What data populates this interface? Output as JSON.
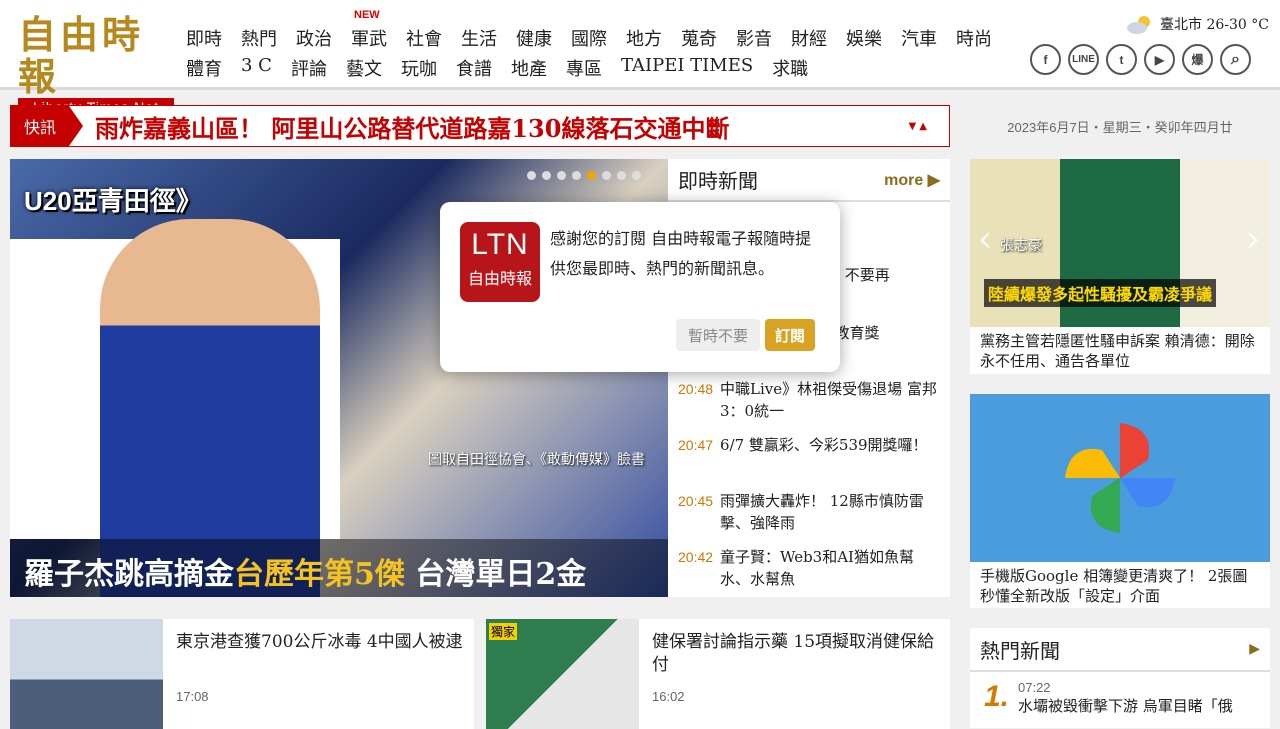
{
  "logo": {
    "cn": "自由時報",
    "en": "Liberty Times Net"
  },
  "nav": {
    "row1": [
      "即時",
      "熱門",
      "政治",
      "軍武",
      "社會",
      "生活",
      "健康",
      "國際",
      "地方",
      "蒐奇",
      "影音",
      "財經",
      "娛樂",
      "汽車",
      "時尚"
    ],
    "row2": [
      "體育",
      "3 C",
      "評論",
      "藝文",
      "玩咖",
      "食譜",
      "地產",
      "專區",
      "TAIPEI TIMES",
      "求職"
    ],
    "new_badge": "NEW"
  },
  "weather": {
    "text": "臺北市 26-30 °C"
  },
  "social": [
    "f",
    "LINE",
    "t",
    "▶",
    "爆",
    "⌕"
  ],
  "flash": {
    "tag": "快訊",
    "text": "雨炸嘉義山區！ 阿里山公路替代道路嘉130線落石交通中斷",
    "controls": "▼  ▲"
  },
  "date": "2023年6月7日‧星期三‧癸卯年四月廿",
  "hero": {
    "tag": "U20亞青田徑》",
    "credit": "圖取自田徑協會、《敢動傳媒》臉書",
    "caption_a": "羅子杰跳高摘金",
    "caption_gold": "台歷年第5傑",
    "caption_b": " 台灣單日2金"
  },
  "instant": {
    "title": "即時新聞",
    "more": "more ▶",
    "items": [
      {
        "time": "",
        "text": "陽照顧 提案約 爭"
      },
      {
        "time": "",
        "text": "是「喝到凌 曝光：不要再"
      },
      {
        "time": "",
        "text": "奔向夢想 同 總統教育獎"
      },
      {
        "time": "20:48",
        "text": "中職Live》林祖傑受傷退場 富邦3：0統一"
      },
      {
        "time": "20:47",
        "text": "6/7 雙贏彩、今彩539開獎囉！"
      },
      {
        "time": "20:45",
        "text": "雨彈擴大轟炸！ 12縣市慎防雷擊、強降雨"
      },
      {
        "time": "20:42",
        "text": "童子賢：Web3和AI猶如魚幫水、水幫魚"
      }
    ]
  },
  "side1": {
    "name": "張志豪",
    "label": "陸續爆發多起性騷擾及霸凌爭議",
    "text": "黨務主管若隱匿性騷申訴案 賴清德：開除永不任用、通告各單位"
  },
  "side2": {
    "text": "手機版Google 相簿變更清爽了！ 2張圖秒懂全新改版「設定」介面"
  },
  "hot": {
    "title": "熱門新聞",
    "num": "1.",
    "time": "07:22",
    "text": "水壩被毀衝擊下游 烏軍目睹「俄"
  },
  "cards": [
    {
      "title": "東京港查獲700公斤冰毒 4中國人被逮",
      "time": "17:08"
    },
    {
      "title": "健保署討論指示藥 15項擬取消健保給付",
      "time": "16:02",
      "badge": "獨家"
    }
  ],
  "modal": {
    "logo_a": "LTN",
    "logo_b": "自由時報",
    "text": "感謝您的訂閱 自由時報電子報隨時提供您最即時、熱門的新聞訊息。",
    "later": "暫時不要",
    "subscribe": "訂閱"
  }
}
